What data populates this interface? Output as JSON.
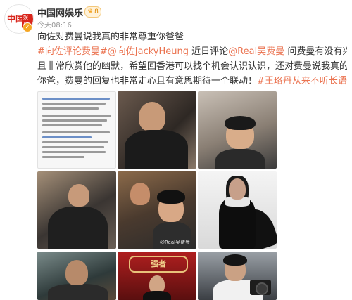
{
  "account": {
    "name": "中国网娱乐",
    "avatar_text": "中国网",
    "avatar_sub": "娱乐",
    "badge_level": "8",
    "timestamp": "今天08:16"
  },
  "post": {
    "line1": "向佐对费曼说我真的非常尊重你爸爸",
    "line2_parts": {
      "tag1": "#向佐评论费曼#",
      "mention1": "@向佐JackyHeung",
      "text1": " 近日评论",
      "mention2": "@Real吴费曼",
      "text2": " 问费曼有没有兴趣拍戏，并"
    },
    "line3": "且非常欣赏他的幽默，希望回香港可以找个机会认识认识，还对费曼说我真的非常尊重",
    "line4_parts": {
      "text": "你爸，费曼的回复也非常走心且有意思期待一个联动！",
      "tag2": "#王珞丹从来不听长语音#"
    }
  },
  "photos": {
    "p8_sign": "强者",
    "watermark": "@Real吴费曼"
  },
  "colors": {
    "accent": "#eb7350",
    "badge": "#f39c12"
  }
}
